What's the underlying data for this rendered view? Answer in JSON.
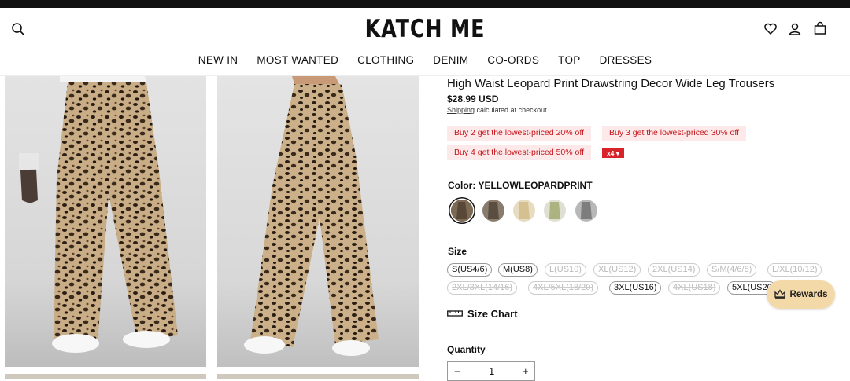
{
  "header": {
    "logo": "KATCH ME",
    "nav": [
      "NEW IN",
      "MOST WANTED",
      "CLOTHING",
      "DENIM",
      "CO-ORDS",
      "TOP",
      "DRESSES"
    ]
  },
  "product": {
    "title": "High Waist Leopard Print Drawstring Decor Wide Leg Trousers",
    "price": "$28.99 USD",
    "shipping_link": "Shipping",
    "shipping_text": " calculated at checkout.",
    "promos": [
      "Buy 2 get the lowest-priced 20% off",
      "Buy 3 get the lowest-priced 30% off",
      "Buy 4 get the lowest-priced 50% off"
    ],
    "promo_more": "x4 ▾",
    "color_label": "Color: YELLOWLEOPARDPRINT",
    "swatch_colors": [
      "#6b5a4a",
      "#5e5246",
      "#d9c9a3",
      "#b6bc8e",
      "#8a8a8a"
    ],
    "size_label": "Size",
    "sizes": [
      {
        "label": "S(US4/6)",
        "available": true
      },
      {
        "label": "M(US8)",
        "available": true
      },
      {
        "label": "L(US10)",
        "available": false
      },
      {
        "label": "XL(US12)",
        "available": false
      },
      {
        "label": "2XL(US14)",
        "available": false
      },
      {
        "label": "S/M(4/6/8)",
        "available": false
      },
      {
        "label": "L/XL(10/12)",
        "available": false
      },
      {
        "label": "2XL/3XL(14/16)",
        "available": false
      },
      {
        "label": "4XL/5XL(18/20)",
        "available": false
      },
      {
        "label": "3XL(US16)",
        "available": true
      },
      {
        "label": "4XL(US18)",
        "available": false
      },
      {
        "label": "5XL(US20)",
        "available": true
      }
    ],
    "size_chart": "Size Chart",
    "quantity_label": "Quantity",
    "quantity": "1",
    "qty_minus": "−",
    "qty_plus": "+"
  },
  "rewards": "Rewards",
  "colors": {
    "promo_text": "#c4161c",
    "promo_bg": "#fde9e9",
    "rewards_bg": "#f4d9a8"
  }
}
